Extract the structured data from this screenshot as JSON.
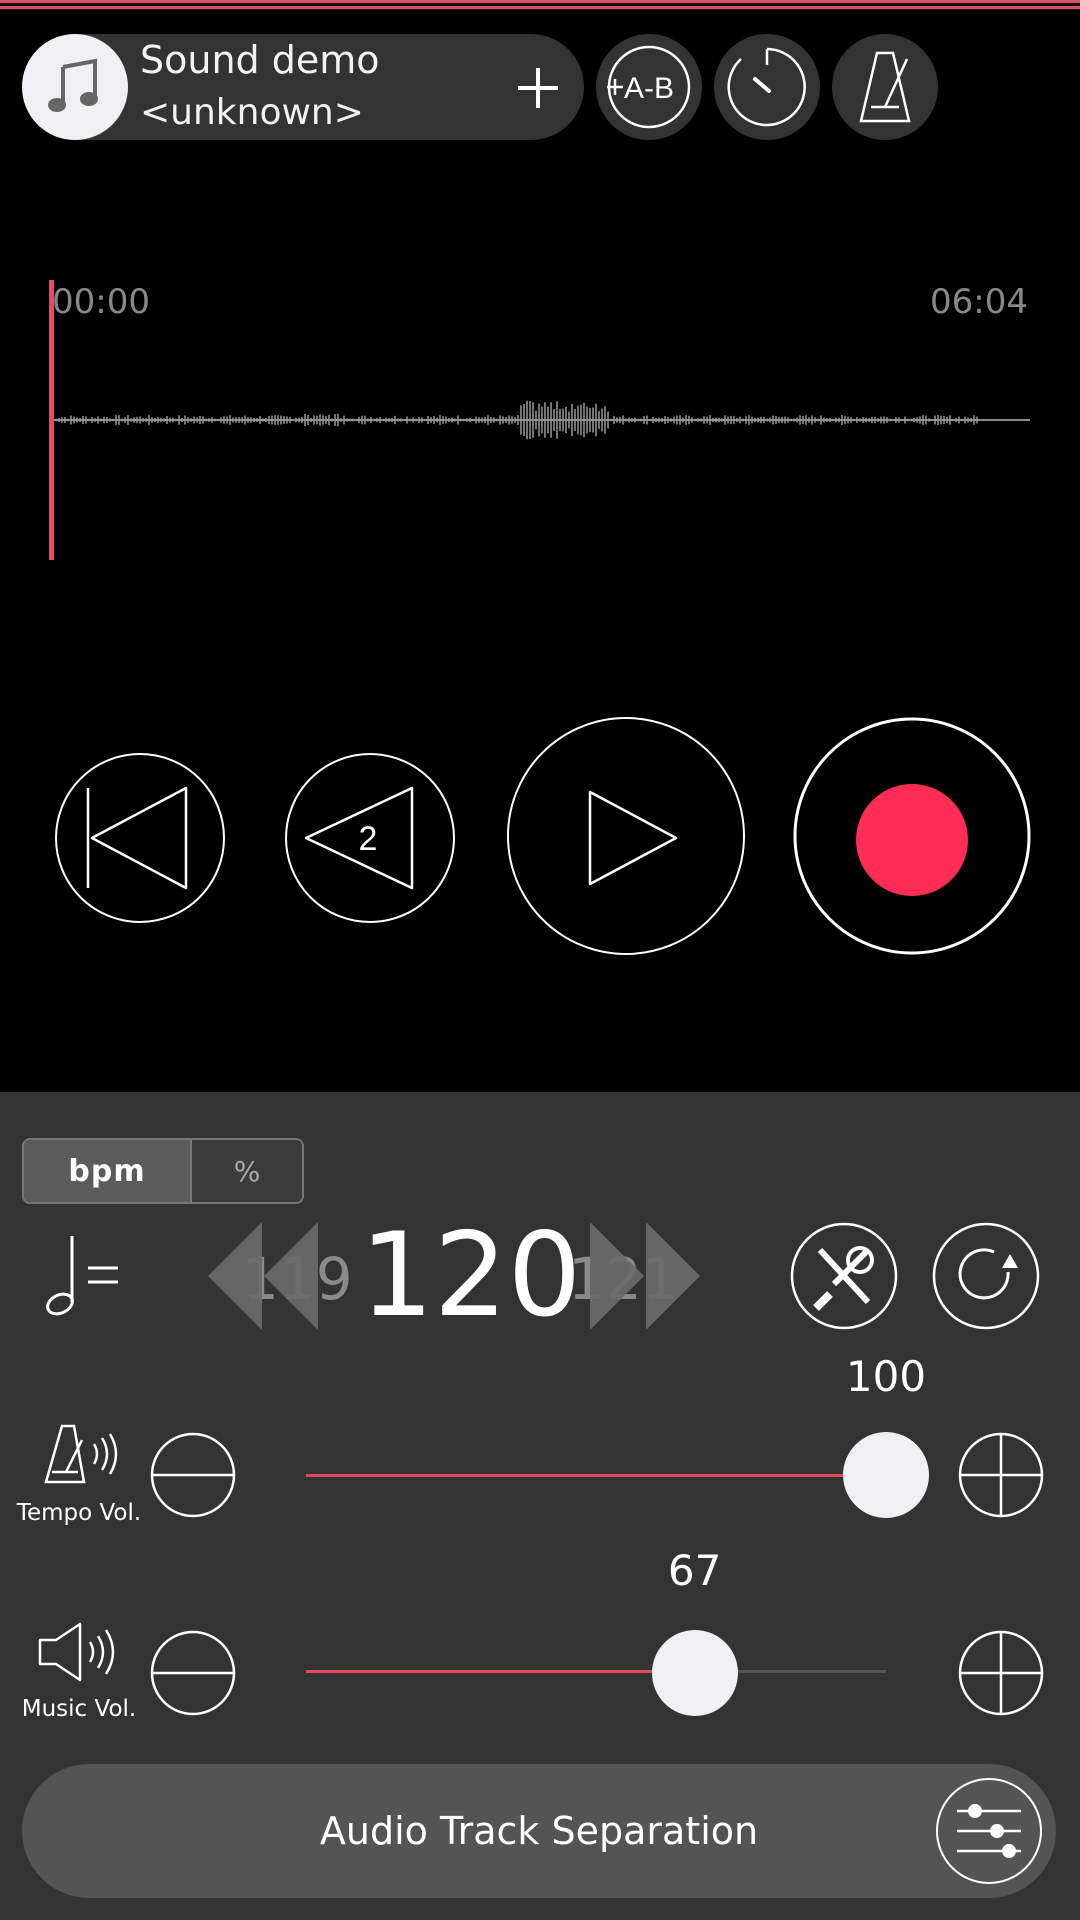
{
  "header": {
    "track_title": "Sound demo",
    "track_artist": "<unknown>",
    "buttons": {
      "add_track": "plus-icon",
      "ab_repeat": "A-B",
      "timer": "timer-icon",
      "metronome": "metronome-icon"
    }
  },
  "waveform": {
    "time_start": "00:00",
    "time_end": "06:04",
    "playhead_position": 0.0
  },
  "transport": {
    "skip_back_icon": "skip-to-start-icon",
    "rewind_seconds": "2",
    "play_icon": "play-icon",
    "record_icon": "record-icon"
  },
  "tempo": {
    "unit_bpm": "bpm",
    "unit_percent": "%",
    "note_symbol": "half-note-equals-icon",
    "prev_value": "119",
    "value": "120",
    "next_value": "121"
  },
  "sliders": {
    "tempo_volume": {
      "label": "Tempo Vol.",
      "value": "100",
      "fraction": 1.0
    },
    "music_volume": {
      "label": "Music Vol.",
      "value": "67",
      "fraction": 0.67
    }
  },
  "footer": {
    "separation_label": "Audio Track Separation"
  },
  "colors": {
    "accent": "#ef4660",
    "record": "#ff2d55",
    "panel": "#333333",
    "background": "#000000"
  }
}
